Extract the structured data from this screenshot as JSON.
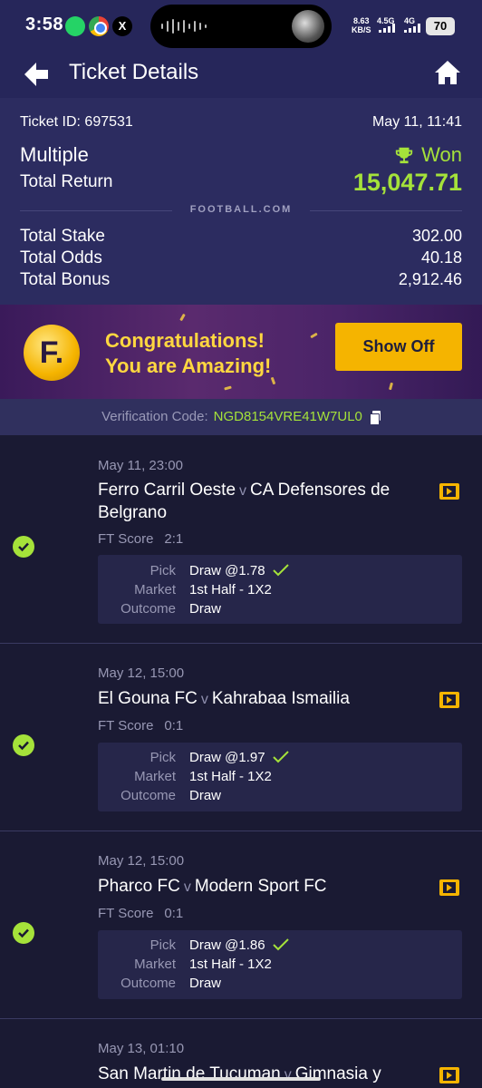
{
  "status_bar": {
    "time": "3:58",
    "net_speed_value": "8.63",
    "net_speed_unit": "KB/S",
    "signal_1": "4.5G",
    "signal_2": "4G",
    "battery": "70",
    "x_app": "X"
  },
  "header": {
    "title": "Ticket Details"
  },
  "ticket": {
    "id_text": "Ticket ID: 697531",
    "date": "May 11, 11:41",
    "type": "Multiple",
    "status": "Won",
    "total_return_label": "Total Return",
    "total_return": "15,047.71",
    "brand": "FOOTBALL.COM",
    "rows": [
      {
        "label": "Total Stake",
        "value": "302.00"
      },
      {
        "label": "Total Odds",
        "value": "40.18"
      },
      {
        "label": "Total Bonus",
        "value": "2,912.46"
      }
    ]
  },
  "promo": {
    "logo_letter": "F.",
    "line1": "Congratulations!",
    "line2": "You are Amazing!",
    "button": "Show Off"
  },
  "verification": {
    "label": "Verification Code:",
    "code": "NGD8154VRE41W7UL0"
  },
  "matches": [
    {
      "date": "May 11, 23:00",
      "home": "Ferro Carril Oeste",
      "vs": "v",
      "away": "CA Defensores de Belgrano",
      "score_label": "FT Score",
      "score": "2:1",
      "pick_label": "Pick",
      "pick": "Draw @1.78",
      "market_label": "Market",
      "market": "1st Half - 1X2",
      "outcome_label": "Outcome",
      "outcome": "Draw"
    },
    {
      "date": "May 12, 15:00",
      "home": "El Gouna FC",
      "vs": "v",
      "away": "Kahrabaa Ismailia",
      "score_label": "FT Score",
      "score": "0:1",
      "pick_label": "Pick",
      "pick": "Draw @1.97",
      "market_label": "Market",
      "market": "1st Half - 1X2",
      "outcome_label": "Outcome",
      "outcome": "Draw"
    },
    {
      "date": "May 12, 15:00",
      "home": "Pharco FC",
      "vs": "v",
      "away": "Modern Sport FC",
      "score_label": "FT Score",
      "score": "0:1",
      "pick_label": "Pick",
      "pick": "Draw @1.86",
      "market_label": "Market",
      "market": "1st Half - 1X2",
      "outcome_label": "Outcome",
      "outcome": "Draw"
    },
    {
      "date": "May 13, 01:10",
      "home": "San Martin de Tucuman",
      "vs": "v",
      "away": "Gimnasia y"
    }
  ],
  "colors": {
    "accent_green": "#a5e23a",
    "accent_yellow": "#f5b400",
    "header_bg": "#26265a",
    "summary_bg": "#2c2c60",
    "list_bg": "#1a1a33"
  },
  "icons": {
    "back": "arrow-left-icon",
    "home": "home-icon",
    "won": "trophy-icon",
    "copy": "copy-icon",
    "check": "check-circle-icon",
    "expand": "chevron-right-box-icon"
  }
}
